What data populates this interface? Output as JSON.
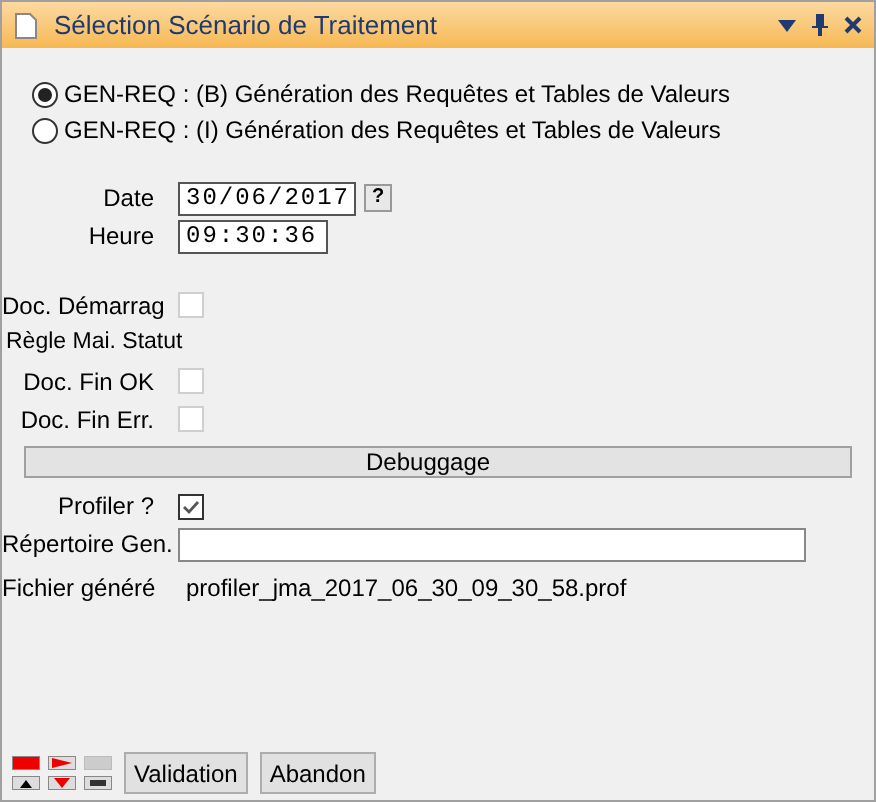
{
  "window": {
    "title": "Sélection Scénario de Traitement"
  },
  "scenarios": [
    {
      "label": "GEN-REQ : (B) Génération des Requêtes et Tables de Valeurs",
      "selected": true
    },
    {
      "label": "GEN-REQ : (I) Génération des Requêtes et Tables de Valeurs",
      "selected": false
    }
  ],
  "date": {
    "label": "Date",
    "value": "30/06/2017",
    "help": "?"
  },
  "time": {
    "label": "Heure",
    "value": "09:30:36"
  },
  "options": [
    {
      "kind": "checkbox",
      "label": "Doc. Démarrag",
      "checked": false,
      "disabled": true
    },
    {
      "kind": "text",
      "label": "Règle Mai. Statut"
    },
    {
      "kind": "checkbox",
      "label": "Doc. Fin OK",
      "checked": false,
      "disabled": true
    },
    {
      "kind": "checkbox",
      "label": "Doc. Fin Err.",
      "checked": false,
      "disabled": true
    }
  ],
  "debug": {
    "header": "Debuggage",
    "profiler": {
      "label": "Profiler ?",
      "checked": true
    },
    "directory": {
      "label": "Répertoire Gen."
    },
    "file": {
      "label": "Fichier généré",
      "value": "profiler_jma_2017_06_30_09_30_58.prof"
    }
  },
  "buttons": [
    "Validation",
    "Abandon"
  ]
}
